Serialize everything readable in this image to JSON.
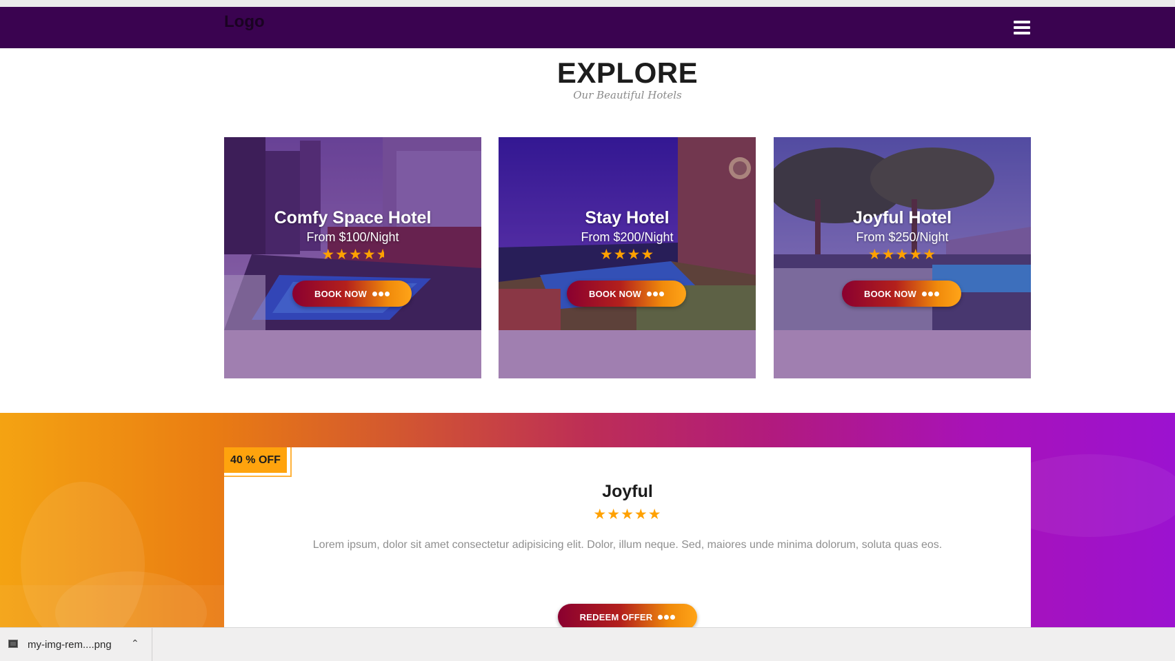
{
  "navbar": {
    "logo": "Logo",
    "menu_icon": "hamburger-menu-icon"
  },
  "explore": {
    "title": "EXPLORE",
    "subtitle": "Our Beautiful Hotels"
  },
  "hotels": [
    {
      "name": "Comfy Space Hotel",
      "price": "From $100/Night",
      "rating": 4.5,
      "button": "BOOK NOW"
    },
    {
      "name": "Stay Hotel",
      "price": "From $200/Night",
      "rating": 4,
      "button": "BOOK NOW"
    },
    {
      "name": "Joyful Hotel",
      "price": "From $250/Night",
      "rating": 5,
      "button": "BOOK NOW"
    }
  ],
  "promo": {
    "badge": "40 % OFF",
    "title": "Joyful",
    "rating": 5,
    "text": "Lorem ipsum, dolor sit amet consectetur adipisicing elit. Dolor, illum neque. Sed, maiores unde minima dolorum, soluta quas eos.",
    "button": "REDEEM OFFER"
  },
  "download_bar": {
    "filename": "my-img-rem....png"
  },
  "colors": {
    "navbar": "#3a0350",
    "accent": "#ffa100",
    "card_panel": "#a07fb0"
  }
}
